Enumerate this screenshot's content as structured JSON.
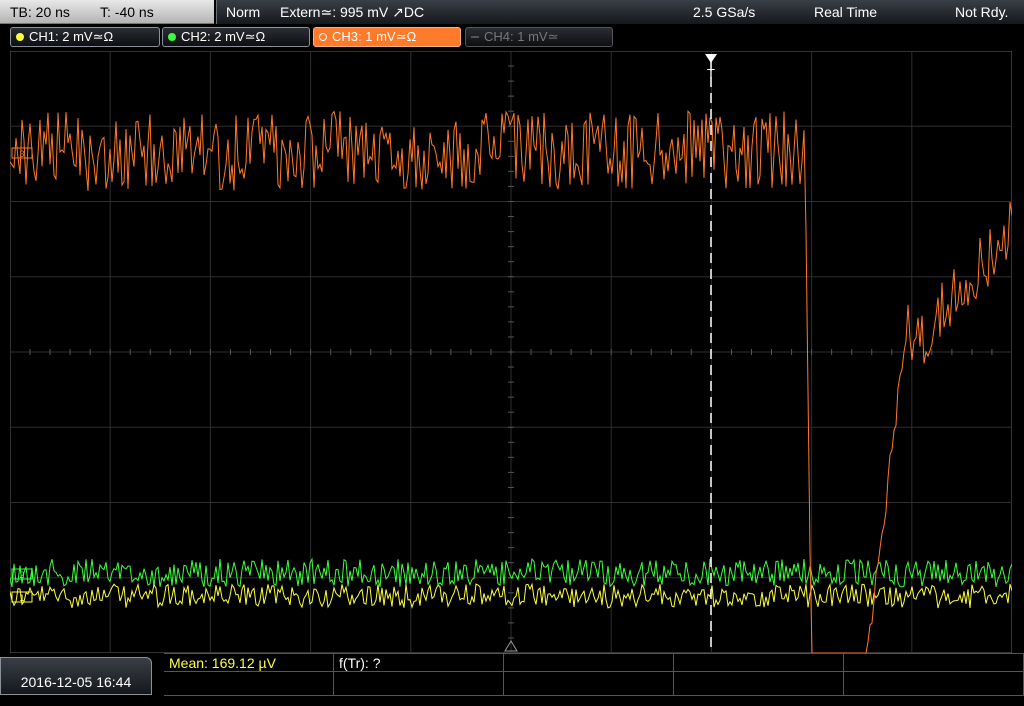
{
  "timebase": {
    "tb": "TB: 20 ns",
    "t": "T: -40 ns"
  },
  "status": {
    "mode": "Norm",
    "trigger": "Extern≃: 995 mV ↗DC",
    "sample_rate": "2.5 GSa/s",
    "acq": "Real Time",
    "ready": "Not Rdy."
  },
  "channels": [
    {
      "label": "CH1: 2 mV≃Ω",
      "color": "#ffff3c",
      "active": true
    },
    {
      "label": "CH2: 2 mV≃Ω",
      "color": "#3cff3c",
      "active": true
    },
    {
      "label": "CH3: 1 mV≃Ω",
      "color": "#ff7a2a",
      "active": true,
      "selected": true
    },
    {
      "label": "CH4: 1 mV≃",
      "color": "#777777",
      "active": false
    }
  ],
  "markers": {
    "trigger": "T",
    "ch3": "3",
    "ch2": "2",
    "ch1": "1"
  },
  "measurements": {
    "mean": "Mean: 169.12 µV",
    "ftr": "f(Tr): ?"
  },
  "datetime": "2016-12-05 16:44"
}
